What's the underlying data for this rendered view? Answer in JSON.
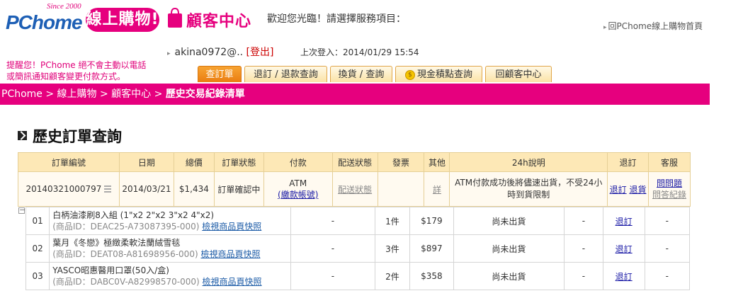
{
  "header": {
    "logo_brand": "PChome",
    "logo_since": "Since 2000",
    "logo_badge": "線上購物!",
    "center_title": "顧客中心",
    "welcome": "歡迎您光臨！請選擇服務項目：",
    "home_link": "回PChome線上購物首頁"
  },
  "user": {
    "username": "akina0972@..",
    "logout": "[登出]",
    "last_login": "上次登入：2014/01/29 15:54"
  },
  "notice": {
    "line1": "提醒您！PChome 絕不會主動以電話",
    "line2": "或簡訊通知顧客變更付款方式。"
  },
  "tabs": [
    {
      "label": "查訂單"
    },
    {
      "label": "退訂 / 退款查詢"
    },
    {
      "label": "換貨 / 查詢"
    },
    {
      "label": "現金積點查詢"
    },
    {
      "label": "回顧客中心"
    }
  ],
  "breadcrumb": {
    "part1": "PChome > 線上購物 > 顧客中心 > ",
    "current": "歷史交易紀錄清單"
  },
  "section_title": "歷史訂單查詢",
  "order_table": {
    "headers": [
      "訂單編號",
      "日期",
      "總價",
      "訂單狀態",
      "付款",
      "配送狀態",
      "發票",
      "其他",
      "24h說明",
      "退訂",
      "客服"
    ],
    "order": {
      "id": "20140321000797",
      "date": "2014/03/21",
      "total": "$1,434",
      "status": "訂單確認中",
      "payment": "ATM",
      "payment_link": "(繳款帳號)",
      "delivery": "配送狀態",
      "invoice": "",
      "other": "詳",
      "note": "ATM付款成功後將儘速出貨，不受24小時到貨限制",
      "cancel1": "退訂",
      "cancel2": "退貨",
      "service1": "問問題",
      "service2": "問答紀錄"
    }
  },
  "items_collapse": "－",
  "items": [
    {
      "no": "01",
      "name": "白柄油漆刷8入組 (1\"x2 2\"x2 3\"x2 4\"x2)",
      "pid": "(商品ID：DEAC25-A73087395-000)",
      "snap": "檢視商品頁快照",
      "c1": "-",
      "qty": "1件",
      "price": "$179",
      "ship": "尚未出貨",
      "c2": "-",
      "cancel": "退訂",
      "c3": "-"
    },
    {
      "no": "02",
      "name": "葉月《冬戀》極緻柔軟法蘭絨雪毯",
      "pid": "(商品ID：DEAT08-A81698956-000)",
      "snap": "檢視商品頁快照",
      "c1": "-",
      "qty": "3件",
      "price": "$897",
      "ship": "尚未出貨",
      "c2": "-",
      "cancel": "退訂",
      "c3": "-"
    },
    {
      "no": "03",
      "name": "YASCO昭惠醫用口罩(50入/盒)",
      "pid": "(商品ID：DABC0V-A82998570-000)",
      "snap": "檢視商品頁快照",
      "c1": "-",
      "qty": "2件",
      "price": "$358",
      "ship": "尚未出貨",
      "c2": "-",
      "cancel": "退訂",
      "c3": "-"
    }
  ],
  "colors": {
    "brand_pink": "#e6007e",
    "brand_blue": "#1d5fb5",
    "tab_orange": "#ea7d12",
    "header_cream": "#fde8b6"
  }
}
